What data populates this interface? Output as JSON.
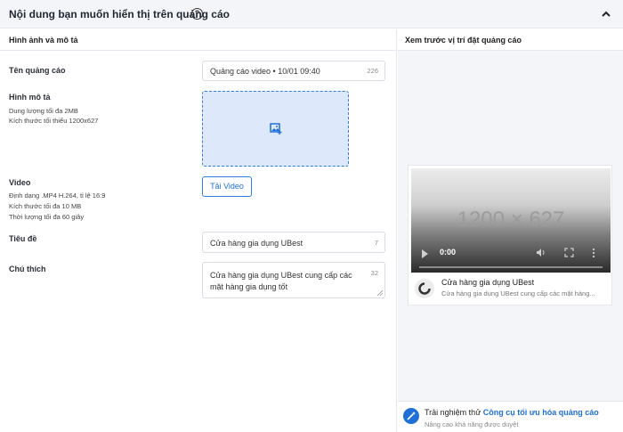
{
  "header": {
    "title": "Nội dung bạn muốn hiển thị trên quảng cáo",
    "help_icon": "question-circle-icon",
    "collapse_icon": "chevron-up-icon"
  },
  "left": {
    "section_title": "Hình ảnh và mô tả",
    "ad_name": {
      "label": "Tên quảng cáo",
      "value": "Quảng cáo video • 10/01 09:40",
      "count": "226"
    },
    "image": {
      "label": "Hình mô tả",
      "hints": [
        "Dung lượng tối đa 2MB",
        "Kích thước tối thiểu 1200x627"
      ],
      "upload_icon": "add-image-icon"
    },
    "video": {
      "label": "Video",
      "hints": [
        "Định dạng .MP4 H.264, tỉ lệ 16:9",
        "Kích thước tối đa 10 MB",
        "Thời lượng tối đa 60 giây"
      ],
      "button": "Tải Video"
    },
    "title": {
      "label": "Tiêu đề",
      "value": "Cửa hàng gia dụng UBest",
      "count": "7"
    },
    "caption": {
      "label": "Chú thích",
      "value_line1": "Cửa hàng gia dụng UBest cung cấp các",
      "value_line2": "mặt hàng gia dụng tốt",
      "count": "32"
    }
  },
  "preview": {
    "title": "Xem trước vị trí đặt quảng cáo",
    "video_placeholder": "1200 × 627",
    "time": "0:00",
    "brand_name": "Cửa hàng gia dụng UBest",
    "brand_desc": "Cửa hàng gia dụng UBest cung cấp các mặt hàng...",
    "tip_prefix": "Trải nghiệm thử ",
    "tip_link": "Công cụ tối ưu hóa quảng cáo",
    "tip_sub": "Nâng cao khả năng được duyệt"
  },
  "colors": {
    "accent": "#1f6fd6",
    "dropzone_bg": "#dde9fb",
    "panel_bg": "#f3f5f9"
  }
}
